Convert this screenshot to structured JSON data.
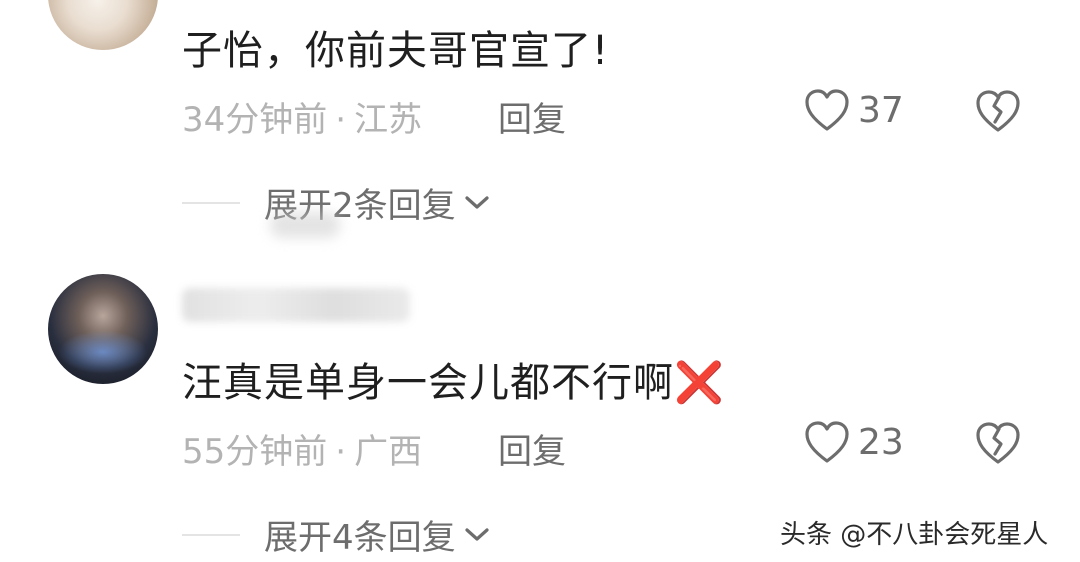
{
  "comments": [
    {
      "text": "子怡，你前夫哥官宣了!",
      "time": "34分钟前",
      "separator": "·",
      "location": "江苏",
      "reply_label": "回复",
      "likes": "37",
      "expand_label": "展开2条回复"
    },
    {
      "text": "汪真是单身一会儿都不行啊",
      "emoji": "❌",
      "time": "55分钟前",
      "separator": "·",
      "location": "广西",
      "reply_label": "回复",
      "likes": "23",
      "expand_label": "展开4条回复"
    }
  ],
  "watermark": "头条 @不八卦会死星人",
  "icons": {
    "like": "heart-outline-icon",
    "dislike": "broken-heart-icon",
    "expand": "chevron-down-icon"
  },
  "colors": {
    "text_primary": "#1f1f1f",
    "text_secondary": "#6d6d6d",
    "text_muted": "#b3b3b3",
    "emoji_red": "#e0322b"
  }
}
